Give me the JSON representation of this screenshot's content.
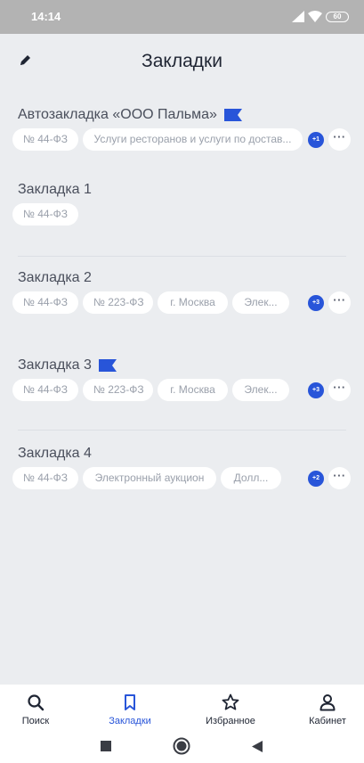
{
  "status": {
    "time": "14:14",
    "battery": "60"
  },
  "header": {
    "title": "Закладки"
  },
  "bookmarks": [
    {
      "title": "Автозакладка «ООО Пальма»",
      "flag": true,
      "chips": [
        "№ 44-ФЗ",
        "Услуги ресторанов и услуги по достав..."
      ],
      "extra": "+1"
    },
    {
      "title": "Закладка 1",
      "flag": false,
      "chips": [
        "№ 44-ФЗ"
      ],
      "extra": ""
    },
    {
      "title": "Закладка 2",
      "flag": false,
      "chips": [
        "№ 44-ФЗ",
        "№ 223-ФЗ",
        "г. Москва",
        "Элек..."
      ],
      "extra": "+3"
    },
    {
      "title": "Закладка 3",
      "flag": true,
      "chips": [
        "№ 44-ФЗ",
        "№ 223-ФЗ",
        "г. Москва",
        "Элек..."
      ],
      "extra": "+3"
    },
    {
      "title": "Закладка 4",
      "flag": false,
      "chips": [
        "№ 44-ФЗ",
        "Электронный аукцион",
        "Долл..."
      ],
      "extra": "+2"
    }
  ],
  "more_label": "···",
  "tabs": [
    {
      "label": "Поиск",
      "icon": "search-icon",
      "active": false
    },
    {
      "label": "Закладки",
      "icon": "bookmark-icon",
      "active": true
    },
    {
      "label": "Избранное",
      "icon": "star-icon",
      "active": false
    },
    {
      "label": "Кабинет",
      "icon": "user-icon",
      "active": false
    }
  ],
  "colors": {
    "accent": "#2855d9",
    "background": "#ebedf0",
    "chip_text": "#9aa0ab",
    "title": "#1f2533"
  }
}
